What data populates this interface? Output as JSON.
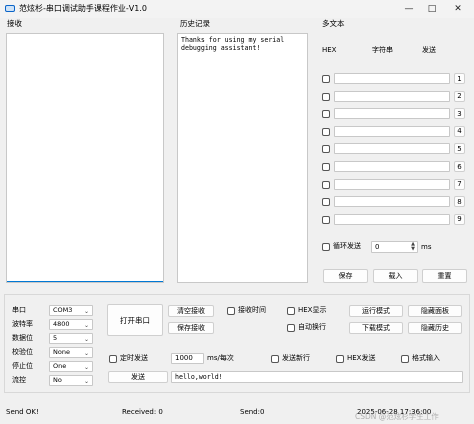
{
  "window": {
    "title": "范炫杉-串口调试助手课程作业-V1.0"
  },
  "receive": {
    "label": "接收",
    "content": ""
  },
  "history": {
    "label": "历史记录",
    "content": "Thanks for using my serial\ndebugging assistant!"
  },
  "multitext": {
    "label": "多文本",
    "col_hex": "HEX",
    "col_string": "字符串",
    "col_send": "发送",
    "rows": [
      {
        "value": "",
        "button": "1"
      },
      {
        "value": "",
        "button": "2"
      },
      {
        "value": "",
        "button": "3"
      },
      {
        "value": "",
        "button": "4"
      },
      {
        "value": "",
        "button": "5"
      },
      {
        "value": "",
        "button": "6"
      },
      {
        "value": "",
        "button": "7"
      },
      {
        "value": "",
        "button": "8"
      },
      {
        "value": "",
        "button": "9"
      }
    ],
    "loop_label": "循环发送",
    "loop_value": "0",
    "loop_unit": "ms",
    "save": "保存",
    "load": "载入",
    "reset": "重置"
  },
  "serial": {
    "port_label": "串口",
    "port_value": "COM3",
    "baud_label": "波特率",
    "baud_value": "4800",
    "databits_label": "数据位",
    "databits_value": "5",
    "parity_label": "校验位",
    "parity_value": "None",
    "stopbits_label": "停止位",
    "stopbits_value": "One",
    "flow_label": "流控",
    "flow_value": "No"
  },
  "controls": {
    "open_port": "打开串口",
    "clear_receive": "清空接收",
    "save_receive": "保存接收",
    "recv_time": "接收时间",
    "hex_display": "HEX显示",
    "auto_wrap": "自动换行",
    "run_mode": "运行模式",
    "hide_panel": "隐藏面板",
    "download_mode": "下载模式",
    "hide_history": "隐藏历史",
    "timed_send": "定时发送",
    "timer_value": "1000",
    "timer_unit": "ms/每次",
    "send_newline": "发送新行",
    "hex_send": "HEX发送",
    "format_input": "格式输入",
    "send": "发送",
    "send_text": "hello,world!"
  },
  "status": {
    "state": "Send OK!",
    "received": "Received: 0",
    "sent": "Send:0",
    "datetime": "2025-06-28 17:36:00",
    "watermark": "CSDN @范炫杉学生工作"
  },
  "colors": {
    "accent": "#0a64c8",
    "focus_underline": "#0078d4"
  }
}
